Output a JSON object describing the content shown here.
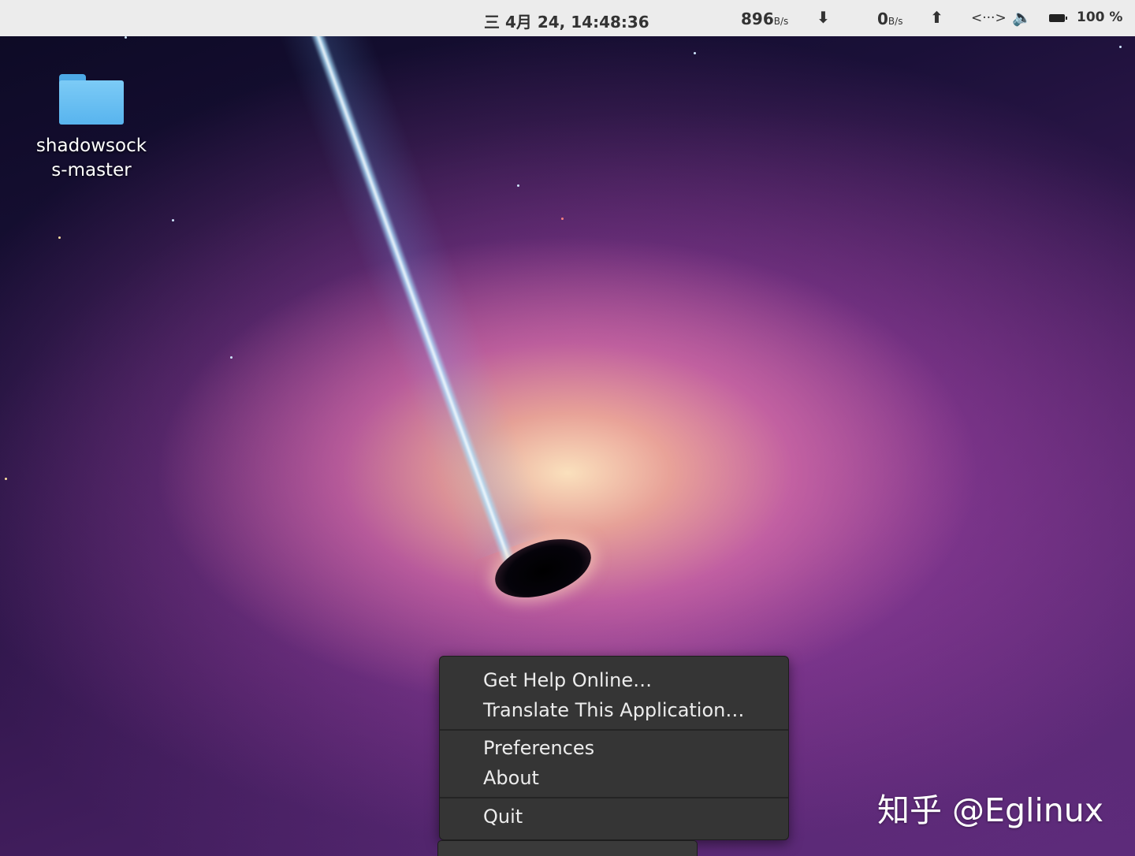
{
  "top_bar": {
    "clock": "三 4月 24, 14:48:36",
    "download_speed": {
      "value": "896",
      "unit": "B/s",
      "icon": "download-arrow-icon"
    },
    "upload_speed": {
      "value": "0",
      "unit": "B/s",
      "icon": "upload-arrow-icon"
    },
    "network_icon": "network-icon",
    "volume_icon": "volume-icon",
    "battery": {
      "icon": "battery-icon",
      "percent": "100 %"
    }
  },
  "desktop": {
    "icons": [
      {
        "label": "shadowsocks-master",
        "icon": "folder-icon"
      }
    ]
  },
  "context_menu": {
    "groups": [
      [
        "Get Help Online…",
        "Translate This Application…"
      ],
      [
        "Preferences",
        "About"
      ],
      [
        "Quit"
      ]
    ]
  },
  "watermark": "知乎 @Eglinux",
  "colors": {
    "topbar_bg": "#ececec",
    "menu_bg": "#353535",
    "folder_blue": "#58b4ee"
  }
}
